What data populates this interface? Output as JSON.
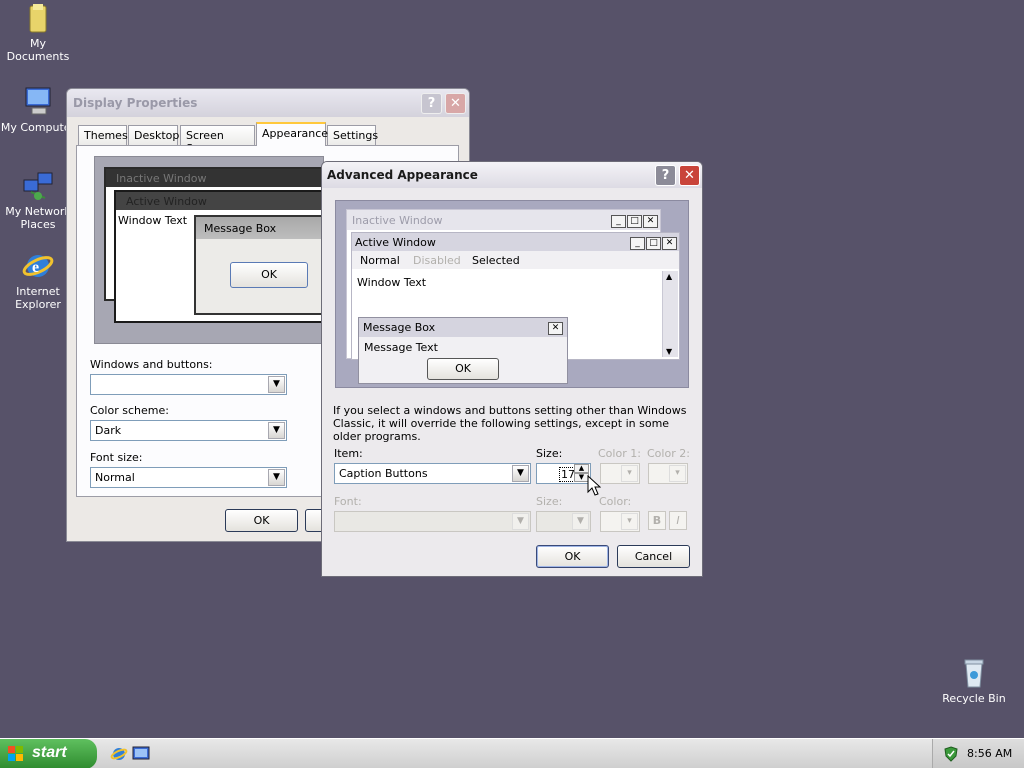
{
  "desktop": {
    "icons": [
      {
        "name": "my-documents",
        "label": "My Documents"
      },
      {
        "name": "my-computer",
        "label": "My Computer"
      },
      {
        "name": "my-network-places",
        "label": "My Network Places"
      },
      {
        "name": "internet-explorer",
        "label": "Internet Explorer"
      },
      {
        "name": "recycle-bin",
        "label": "Recycle Bin"
      }
    ]
  },
  "display_properties": {
    "title": "Display Properties",
    "help_glyph": "?",
    "close_glyph": "✕",
    "tabs": [
      "Themes",
      "Desktop",
      "Screen Saver",
      "Appearance",
      "Settings"
    ],
    "active_tab": "Appearance",
    "preview": {
      "inactive_title": "Inactive Window",
      "active_title": "Active Window",
      "window_text": "Window Text",
      "message_box_title": "Message Box",
      "ok_label": "OK"
    },
    "windows_buttons_label": "Windows and buttons:",
    "windows_buttons_value": "",
    "color_scheme_label": "Color scheme:",
    "color_scheme_value": "Dark",
    "font_size_label": "Font size:",
    "font_size_value": "Normal",
    "ok_label": "OK"
  },
  "advanced_appearance": {
    "title": "Advanced Appearance",
    "help_glyph": "?",
    "close_glyph": "✕",
    "preview": {
      "inactive_title": "Inactive Window",
      "active_title": "Active Window",
      "menu_normal": "Normal",
      "menu_disabled": "Disabled",
      "menu_selected": "Selected",
      "window_text": "Window Text",
      "message_box_title": "Message Box",
      "message_text": "Message Text",
      "ok_label": "OK"
    },
    "info_text": "If you select a windows and buttons setting other than Windows Classic, it will override the following settings, except in some older programs.",
    "item_label": "Item:",
    "item_value": "Caption Buttons",
    "size_label": "Size:",
    "size_value": "17",
    "color1_label": "Color 1:",
    "color2_label": "Color 2:",
    "font_label": "Font:",
    "font_size_label": "Size:",
    "font_color_label": "Color:",
    "bold_label": "B",
    "italic_label": "I",
    "ok_label": "OK",
    "cancel_label": "Cancel"
  },
  "taskbar": {
    "start_label": "start",
    "clock": "8:56 AM"
  },
  "colors": {
    "desktop_bg": "#575269",
    "taskbar": "#dcdcdc",
    "start_green": "#3c9a3c"
  }
}
